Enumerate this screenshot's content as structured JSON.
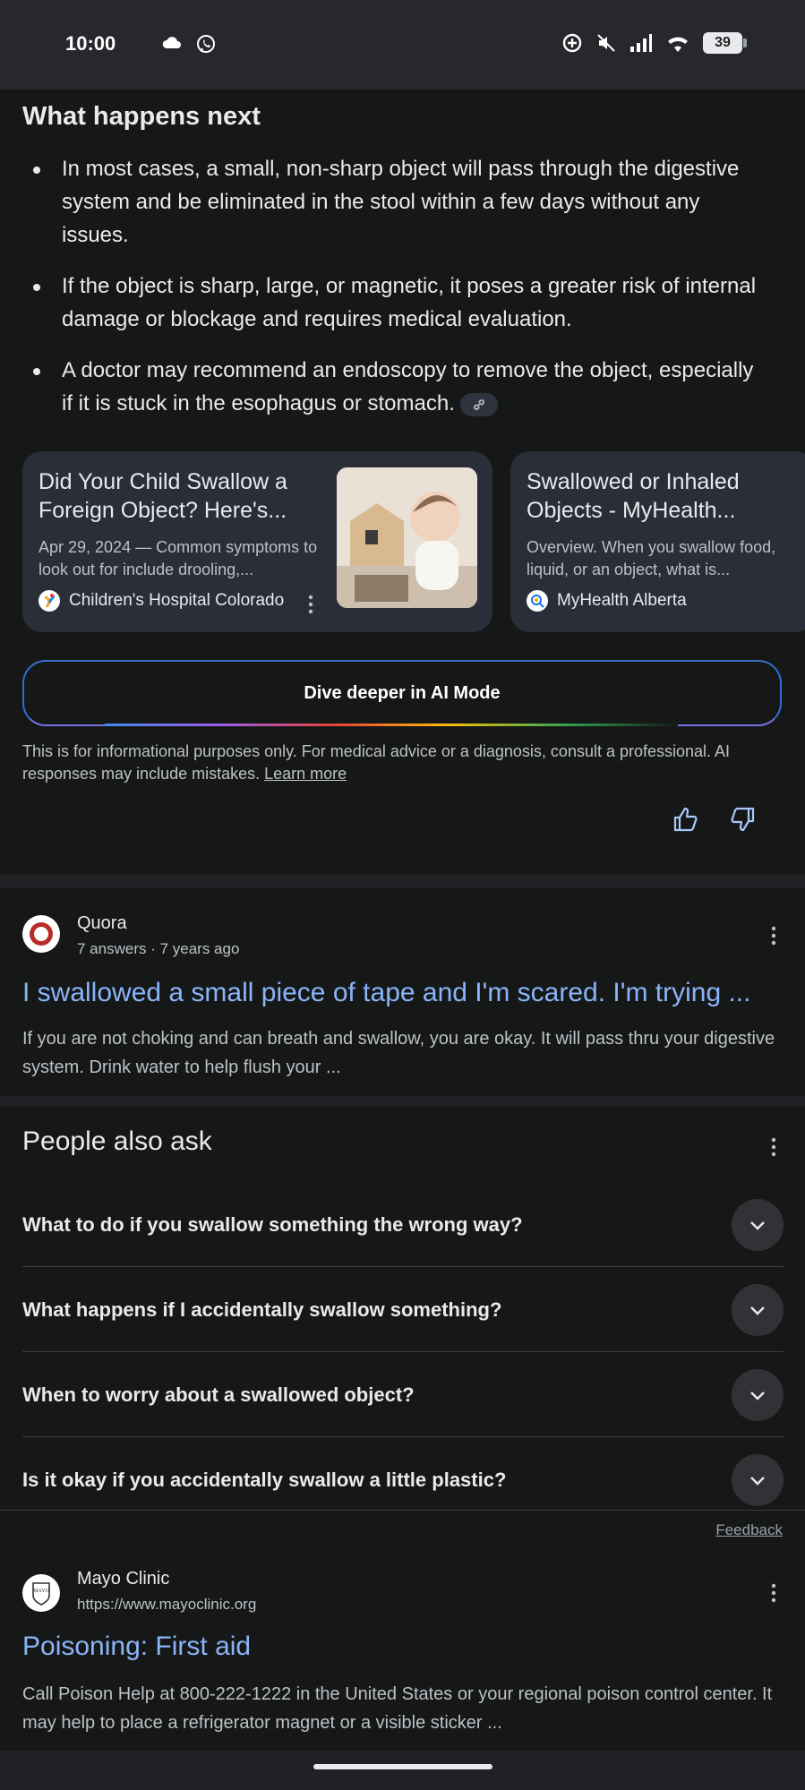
{
  "status": {
    "time": "10:00",
    "battery": "39"
  },
  "ai_overview": {
    "heading": "What happens next",
    "bullets": [
      "In most cases, a small, non-sharp object will pass through the digestive system and be eliminated in the stool within a few days without any issues.",
      "If the object is sharp, large, or magnetic, it poses a greater risk of internal damage or blockage and requires medical evaluation.",
      "A doctor may recommend an endoscopy to remove the object, especially if it is stuck in the esophagus or stomach."
    ],
    "cards": [
      {
        "title": "Did Your Child Swallow a Foreign Object? Here's...",
        "snippet": "Apr 29, 2024 — Common symptoms to look out for include drooling,...",
        "source": "Children's Hospital Colorado"
      },
      {
        "title": "Swallowed or Inhaled Objects - MyHealth...",
        "snippet": "Overview. When you swallow food, liquid, or an object, what is...",
        "source": "MyHealth Alberta"
      }
    ],
    "dive_label": "Dive deeper in AI Mode",
    "disclaimer": "This is for informational purposes only. For medical advice or a diagnosis, consult a professional. AI responses may include mistakes.",
    "learn_more": "Learn more"
  },
  "quora": {
    "site": "Quora",
    "meta": "7 answers · 7 years ago",
    "title": "I swallowed a small piece of tape and I'm scared. I'm trying ...",
    "snippet": "If you are not choking and can breath and swallow, you are okay. It will pass thru your digestive system. Drink water to help flush your ..."
  },
  "paa": {
    "title": "People also ask",
    "questions": [
      "What to do if you swallow something the wrong way?",
      "What happens if I accidentally swallow something?",
      "When to worry about a swallowed object?",
      "Is it okay if you accidentally swallow a little plastic?"
    ],
    "feedback": "Feedback"
  },
  "mayo": {
    "site": "Mayo Clinic",
    "url": "https://www.mayoclinic.org",
    "title": "Poisoning: First aid",
    "snippet": "Call Poison Help at 800-222-1222 in the United States or your regional poison control center. It may help to place a refrigerator magnet or a visible sticker ..."
  },
  "colors": {
    "link": "#8ab4f8",
    "background": "#161818",
    "card": "#292e38"
  }
}
